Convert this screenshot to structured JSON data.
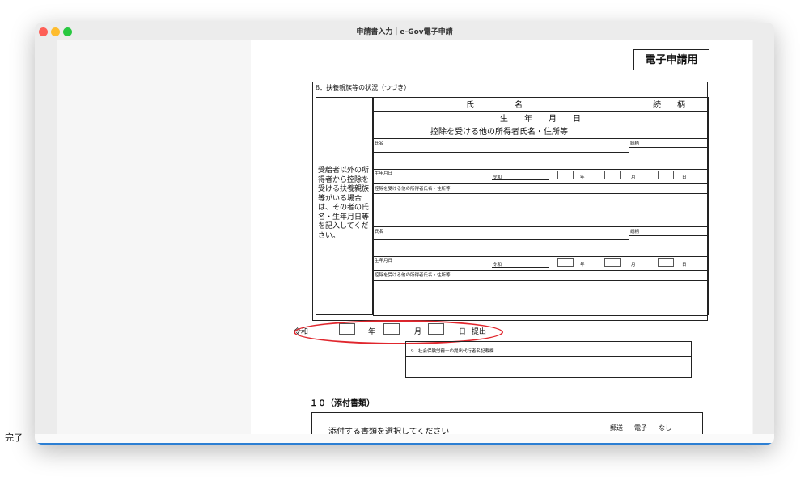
{
  "window": {
    "title": "申請書入力｜e-Gov電子申請"
  },
  "status": {
    "text": "完了"
  },
  "form": {
    "stamp": "電子申請用",
    "section8_title": "8．扶養親族等の状況（つづき）",
    "left_label": "受給者以外の所得者から控除を受ける扶養親族等がいる場合は、その者の氏名・生年月日等を記入してください。",
    "header": {
      "name": "氏　　　　　名",
      "relation": "続　　柄",
      "birth": "生　　年　　月　　日",
      "other": "控除を受ける他の所得者氏名・住所等"
    },
    "entries": [
      {
        "name_label": "氏名",
        "relation_label": "続柄",
        "birth_label": "生年月日",
        "era": "令和",
        "year": "年",
        "month": "月",
        "day": "日",
        "other_label": "控除を受ける他の所得者氏名・住所等"
      },
      {
        "name_label": "氏名",
        "relation_label": "続柄",
        "birth_label": "生年月日",
        "era": "令和",
        "year": "年",
        "month": "月",
        "day": "日",
        "other_label": "控除を受ける他の所得者氏名・住所等"
      }
    ],
    "submit": {
      "era": "令和",
      "year": "年",
      "month": "月",
      "day": "日",
      "suffix": "提出"
    },
    "section9_label": "9．社会保険労務士の提出代行者名記載欄",
    "section10_title": "１０（添付書類）",
    "attach_prompt": "添付する書類を選択してください",
    "attach_options": [
      "郵送",
      "電子",
      "なし"
    ]
  }
}
